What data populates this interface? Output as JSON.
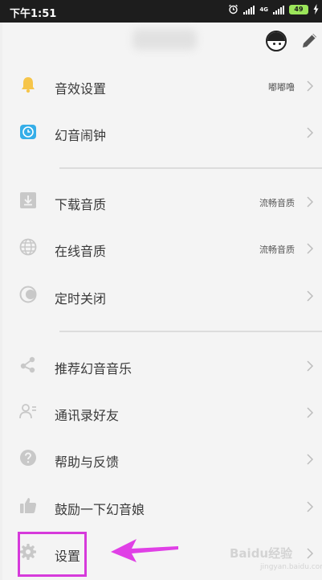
{
  "status_bar": {
    "time": "下午1:51",
    "network_label": "4G",
    "battery_level": "49",
    "icons": [
      "alarm-icon",
      "signal-icon",
      "signal-4g-icon",
      "battery-icon",
      "charging-icon"
    ]
  },
  "header": {
    "avatar_icon": "avatar-icon",
    "edit_icon": "pencil-icon"
  },
  "menu": {
    "items": [
      {
        "label": "音效设置",
        "value": "嘟嘟噜",
        "icon": "bell-icon",
        "icon_color": "#f6c54a"
      },
      {
        "label": "幻音闹钟",
        "value": "",
        "icon": "alarm-clock-icon",
        "icon_color": "#35aee8"
      },
      {
        "label": "下载音质",
        "value": "流畅音质",
        "icon": "download-icon",
        "icon_color": "#c8c8c8"
      },
      {
        "label": "在线音质",
        "value": "流畅音质",
        "icon": "globe-icon",
        "icon_color": "#c8c8c8"
      },
      {
        "label": "定时关闭",
        "value": "",
        "icon": "timer-toggle-icon",
        "icon_color": "#c8c8c8"
      },
      {
        "label": "推荐幻音音乐",
        "value": "",
        "icon": "share-icon",
        "icon_color": "#c8c8c8"
      },
      {
        "label": "通讯录好友",
        "value": "",
        "icon": "contacts-icon",
        "icon_color": "#c8c8c8"
      },
      {
        "label": "帮助与反馈",
        "value": "",
        "icon": "help-icon",
        "icon_color": "#c8c8c8"
      },
      {
        "label": "鼓励一下幻音娘",
        "value": "",
        "icon": "thumbs-up-icon",
        "icon_color": "#c8c8c8"
      },
      {
        "label": "设置",
        "value": "",
        "icon": "gear-icon",
        "icon_color": "#c8c8c8"
      }
    ]
  },
  "annotation": {
    "highlight_color": "#d63adb",
    "arrow_color": "#e040e6"
  },
  "watermark": {
    "text": "Baidu经验",
    "subtext": "jingyan.baidu.com"
  }
}
